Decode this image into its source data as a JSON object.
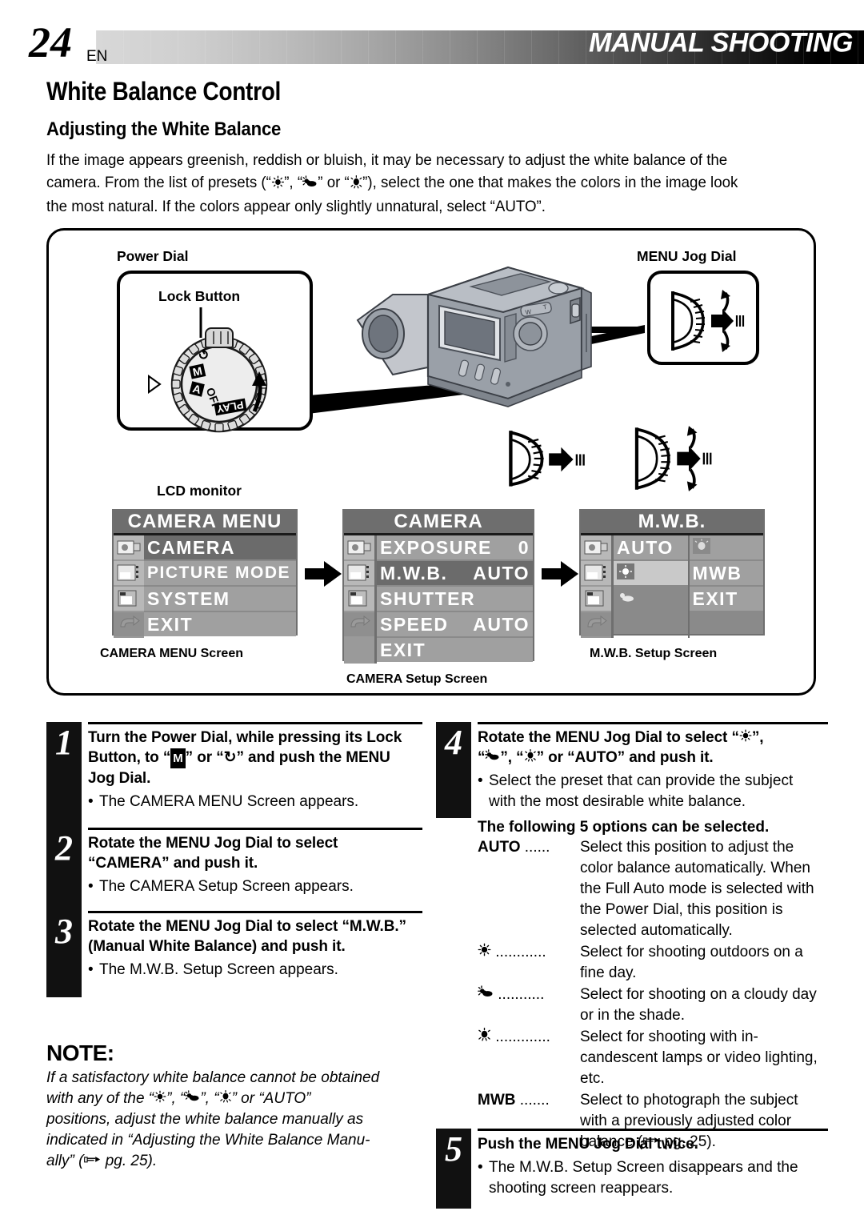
{
  "header": {
    "page_number": "24",
    "region_code": "EN",
    "section_title": "MANUAL SHOOTING"
  },
  "titles": {
    "h1": "White Balance Control",
    "h2": "Adjusting the White Balance"
  },
  "intro": {
    "line1": "If the image appears greenish, reddish or bluish, it may be necessary to adjust the white balance of the",
    "line2_a": "camera. From the list of presets (“",
    "line2_b": "”, “",
    "line2_c": "” or “",
    "line2_d": "”), select the one that makes the colors in the image look",
    "line3": "the most natural. If the colors appear only slightly unnatural, select “AUTO”."
  },
  "diagram": {
    "power_dial_label": "Power Dial",
    "lock_button_label": "Lock Button",
    "menu_jog_dial_label": "MENU Jog Dial",
    "lcd_monitor_label": "LCD monitor",
    "dial_marks": {
      "timer": "↺",
      "manual": "M",
      "auto": "A",
      "off": "OFF",
      "play": "PLAY"
    },
    "captions": {
      "camera_menu": "CAMERA MENU Screen",
      "camera_setup": "CAMERA Setup Screen",
      "mwb_setup": "M.W.B. Setup Screen"
    }
  },
  "screens": {
    "camera_menu": {
      "title": "CAMERA MENU",
      "rows": [
        {
          "label": "CAMERA",
          "value": "",
          "selected": true
        },
        {
          "label": "PICTURE MODE",
          "value": "",
          "selected": false
        },
        {
          "label": "SYSTEM",
          "value": "",
          "selected": false
        },
        {
          "label": "EXIT",
          "value": "",
          "selected": false
        }
      ]
    },
    "camera_setup": {
      "title": "CAMERA",
      "rows": [
        {
          "label": "EXPOSURE",
          "value": "0",
          "selected": false
        },
        {
          "label": "M.W.B.",
          "value": "AUTO",
          "selected": true
        },
        {
          "label": "SHUTTER",
          "value": "",
          "selected": false
        },
        {
          "label": "SPEED",
          "value": "AUTO",
          "selected": false
        },
        {
          "label": "EXIT",
          "value": "",
          "selected": false
        }
      ]
    },
    "mwb_setup": {
      "title": "M.W.B.",
      "left_column": [
        {
          "label": "AUTO",
          "icon": "",
          "selected": false
        },
        {
          "label": "",
          "icon": "sun-icon",
          "selected": true
        },
        {
          "label": "",
          "icon": "cloud-icon",
          "selected": false
        }
      ],
      "right_column": [
        {
          "label": "",
          "icon": "lamp-icon",
          "selected": false
        },
        {
          "label": "MWB",
          "icon": "",
          "selected": false
        },
        {
          "label": "EXIT",
          "icon": "",
          "selected": false
        }
      ]
    }
  },
  "steps_left": [
    {
      "number": "1",
      "bold_lines": [
        "Turn the Power Dial, while pressing its Lock",
        "Button, to “M” or “↺” and push the MENU",
        "Jog Dial."
      ],
      "notes": [
        "The CAMERA MENU Screen appears."
      ]
    },
    {
      "number": "2",
      "bold_lines": [
        "Rotate the MENU Jog Dial to select",
        "“CAMERA” and push it."
      ],
      "notes": [
        "The CAMERA Setup Screen appears."
      ]
    },
    {
      "number": "3",
      "bold_lines": [
        "Rotate the MENU Jog Dial to select “M.W.B.”",
        "(Manual White Balance) and push it."
      ],
      "notes": [
        "The M.W.B. Setup Screen appears."
      ]
    }
  ],
  "step4": {
    "number": "4",
    "bold_line1_a": "Rotate the MENU Jog Dial to select “",
    "bold_line1_b": "”,",
    "bold_line2_a": "“",
    "bold_line2_b": "”, “",
    "bold_line2_c": "” or “AUTO” and push it.",
    "notes": [
      "Select the preset that can provide the subject",
      "with the most desirable white balance."
    ],
    "options_heading": "The following 5 options can be selected.",
    "options": [
      {
        "key": "AUTO",
        "key_type": "text",
        "dots": "......",
        "desc_lines": [
          "Select this position to adjust the",
          "color balance automatically. When",
          "the Full Auto mode is selected with",
          "the Power Dial, this position is",
          "selected automatically."
        ]
      },
      {
        "key": "",
        "key_type": "sun-icon",
        "dots": "............",
        "desc_lines": [
          "Select for shooting outdoors on a",
          "fine day."
        ]
      },
      {
        "key": "",
        "key_type": "cloud-icon",
        "dots": "...........",
        "desc_lines": [
          "Select for shooting on a cloudy day",
          "or in the shade."
        ]
      },
      {
        "key": "",
        "key_type": "lamp-icon",
        "dots": ".............",
        "desc_lines": [
          "Select for shooting with in-",
          "candescent lamps or video lighting,",
          "etc."
        ]
      },
      {
        "key": "MWB",
        "key_type": "text",
        "dots": ".......",
        "desc_lines": [
          "Select to photograph the subject",
          "with a previously adjusted color",
          "balance (☞ pg. 25)."
        ]
      }
    ]
  },
  "step5": {
    "number": "5",
    "bold_lines": [
      "Push the MENU Jog Dial twice."
    ],
    "notes": [
      "The M.W.B. Setup Screen disappears and the",
      "shooting screen reappears."
    ]
  },
  "note": {
    "heading": "NOTE:",
    "line1": "If a satisfactory white balance cannot be obtained",
    "line2_a": "with any of the “",
    "line2_b": "”, “",
    "line2_c": "”, “",
    "line2_d": "” or “AUTO”",
    "line3": "positions, adjust the white balance manually as",
    "line4": "indicated in “Adjusting the White Balance Manu-",
    "line5_a": "ally” (",
    "line5_b": " pg. 25)."
  },
  "icons": {
    "sun": "sun-icon",
    "cloud": "cloud-icon",
    "lamp": "lamp-icon",
    "pointing_hand": "pointing-hand-icon"
  }
}
